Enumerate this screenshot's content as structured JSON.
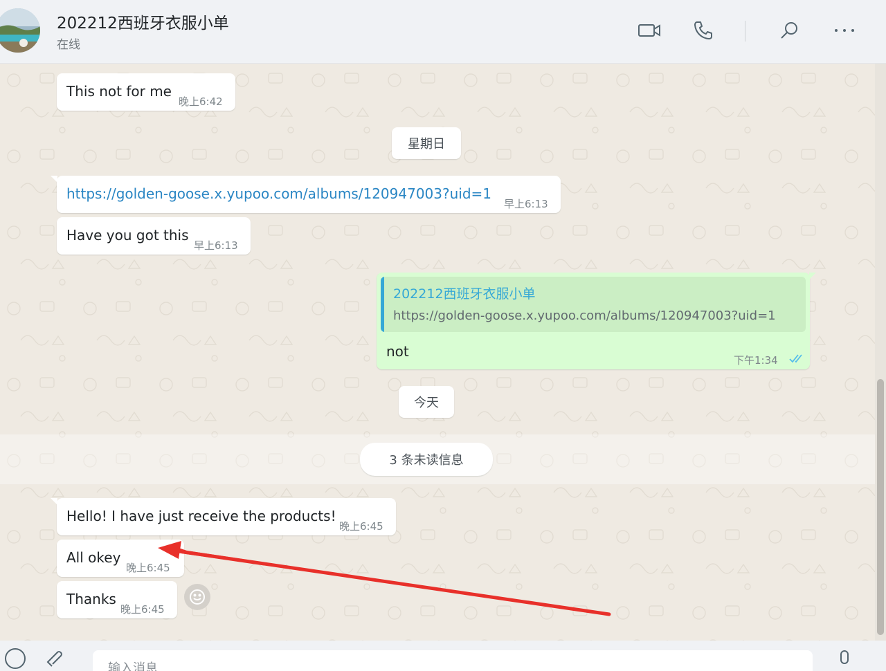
{
  "header": {
    "title": "202212西班牙衣服小单",
    "status": "在线",
    "icons": [
      "video-call-icon",
      "voice-call-icon",
      "search-icon",
      "more-options-icon"
    ]
  },
  "messages": {
    "m1": {
      "text": "This not for me",
      "time": "晚上6:42"
    },
    "day_sunday": "星期日",
    "m2": {
      "text": "https://golden-goose.x.yupoo.com/albums/120947003?uid=1",
      "time": "早上6:13"
    },
    "m3": {
      "text": "Have you got this",
      "time": "早上6:13"
    },
    "m4": {
      "quote_author": "202212西班牙衣服小单",
      "quote_text": "https://golden-goose.x.yupoo.com/albums/120947003?uid=1",
      "text": "not",
      "time": "下午1:34",
      "status": "read"
    },
    "day_today": "今天",
    "unread": "3 条未读信息",
    "m5": {
      "text": "Hello! I have just receive the products!",
      "time": "晚上6:45"
    },
    "m6": {
      "text": "All okey",
      "time": "晚上6:45"
    },
    "m7": {
      "text": "Thanks",
      "time": "晚上6:45"
    }
  },
  "composer": {
    "placeholder": "输入消息"
  },
  "colors": {
    "chat_bg": "#efeae2",
    "outgoing_bubble": "#d9fdd3",
    "link": "#2a86c4",
    "quote_accent": "#35a8d6",
    "read_ticks": "#53bdeb",
    "annotation_arrow": "#e8302a"
  }
}
